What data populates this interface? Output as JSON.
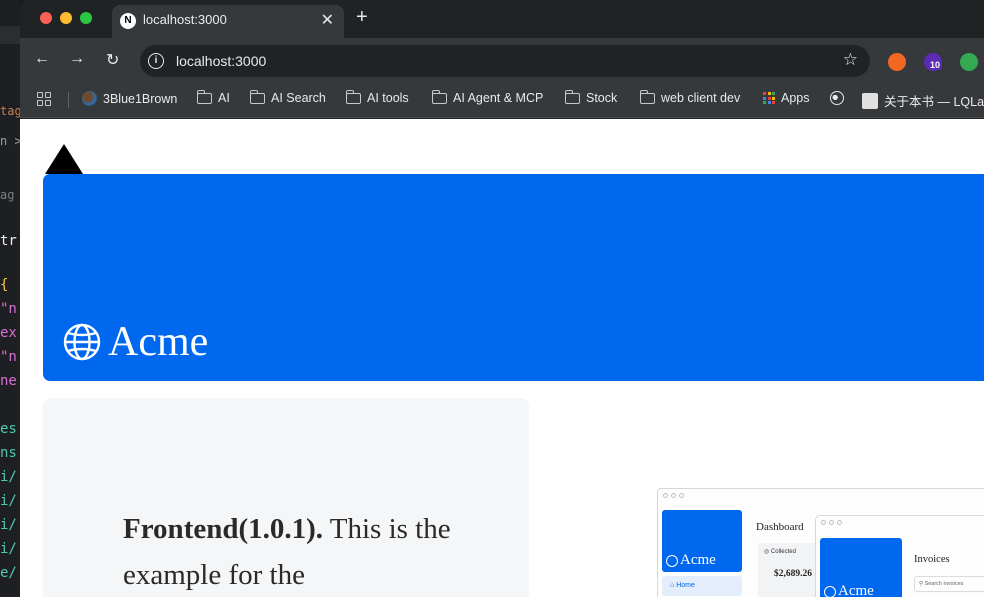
{
  "editor_strip": {
    "lines": [
      "tag",
      "n >",
      "ag",
      "tr",
      "{",
      "\"n",
      "ex",
      "\"n",
      "ne",
      "es",
      "ns",
      "i/",
      "i/",
      "i/",
      "i/",
      "e/"
    ]
  },
  "tab": {
    "favicon": "N",
    "title": "localhost:3000",
    "close": "✕"
  },
  "new_tab": "+",
  "toolbar": {
    "back": "←",
    "forward": "→",
    "reload": "↻",
    "url": "localhost:3000",
    "star": "☆",
    "extension_badge": "10"
  },
  "bookmarks": [
    {
      "label": "3Blue1Brown",
      "icon": "3b1b-icon"
    },
    {
      "label": "AI",
      "icon": "folder-icon"
    },
    {
      "label": "AI Search",
      "icon": "folder-icon"
    },
    {
      "label": "AI tools",
      "icon": "folder-icon"
    },
    {
      "label": "AI Agent & MCP",
      "icon": "folder-icon"
    },
    {
      "label": "Stock",
      "icon": "folder-icon"
    },
    {
      "label": "web client dev",
      "icon": "folder-icon"
    },
    {
      "label": "Apps",
      "icon": "apps-grid-icon"
    },
    {
      "label": "",
      "icon": "globe-icon"
    },
    {
      "label": "关于本书 — LQLab",
      "icon": "site-icon"
    }
  ],
  "page": {
    "hero_brand": "Acme",
    "card_bold": "Frontend(1.0.1).",
    "card_rest": " This is the example for the"
  },
  "preview": {
    "brand": "Acme",
    "dashboard_title": "Dashboard",
    "collected_label": "Collected",
    "collected_value": "$2,689.26",
    "home_label": "Home",
    "invoices_title": "Invoices",
    "search_placeholder": "Search invoices"
  },
  "colors": {
    "brand_blue": "#0068ef",
    "chrome_dark": "#1f2323",
    "chrome_toolbar": "#35393b"
  }
}
